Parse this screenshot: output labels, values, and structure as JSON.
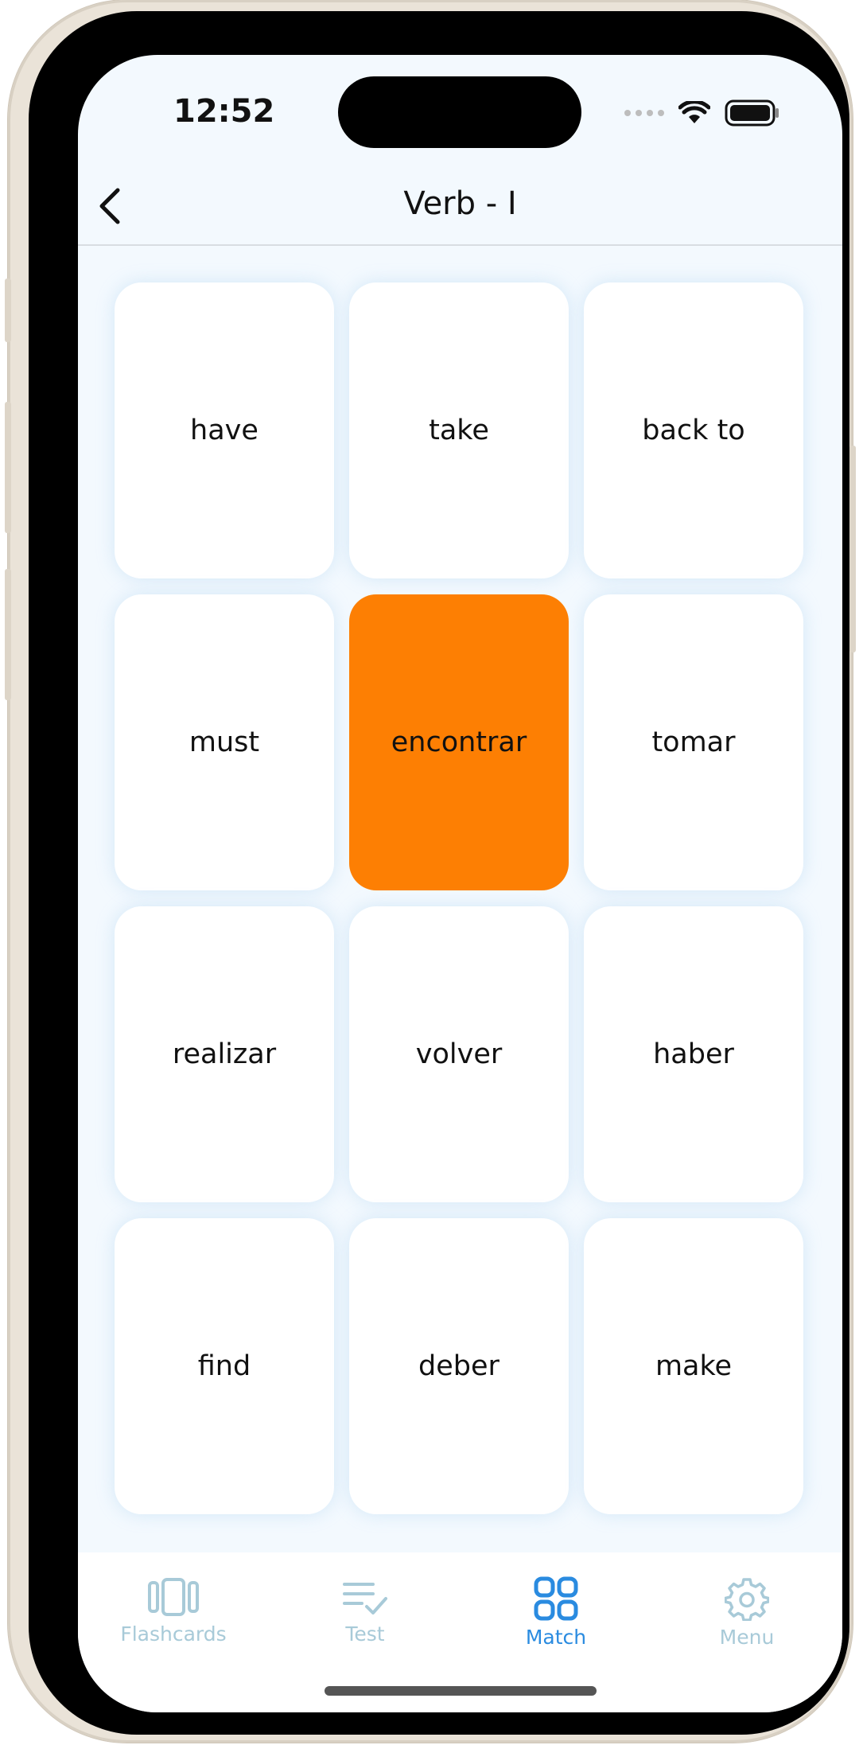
{
  "status_bar": {
    "time": "12:52",
    "icons": [
      "signal-icon",
      "wifi-icon",
      "battery-icon"
    ]
  },
  "header": {
    "title": "Verb - I",
    "back_icon": "chevron-left-icon"
  },
  "cards": [
    {
      "label": "have",
      "selected": false
    },
    {
      "label": "take",
      "selected": false
    },
    {
      "label": "back to",
      "selected": false
    },
    {
      "label": "must",
      "selected": false
    },
    {
      "label": "encontrar",
      "selected": true
    },
    {
      "label": "tomar",
      "selected": false
    },
    {
      "label": "realizar",
      "selected": false
    },
    {
      "label": "volver",
      "selected": false
    },
    {
      "label": "haber",
      "selected": false
    },
    {
      "label": "find",
      "selected": false
    },
    {
      "label": "deber",
      "selected": false
    },
    {
      "label": "make",
      "selected": false
    }
  ],
  "tabs": [
    {
      "label": "Flashcards",
      "icon": "flashcards-icon",
      "active": false
    },
    {
      "label": "Test",
      "icon": "test-checklist-icon",
      "active": false
    },
    {
      "label": "Match",
      "icon": "match-grid-icon",
      "active": true
    },
    {
      "label": "Menu",
      "icon": "gear-icon",
      "active": false
    }
  ],
  "colors": {
    "accent": "#2a8be0",
    "selected_card": "#fd7f03",
    "inactive_tab": "#a8cad8",
    "screen_background": "#f3f9fe"
  }
}
